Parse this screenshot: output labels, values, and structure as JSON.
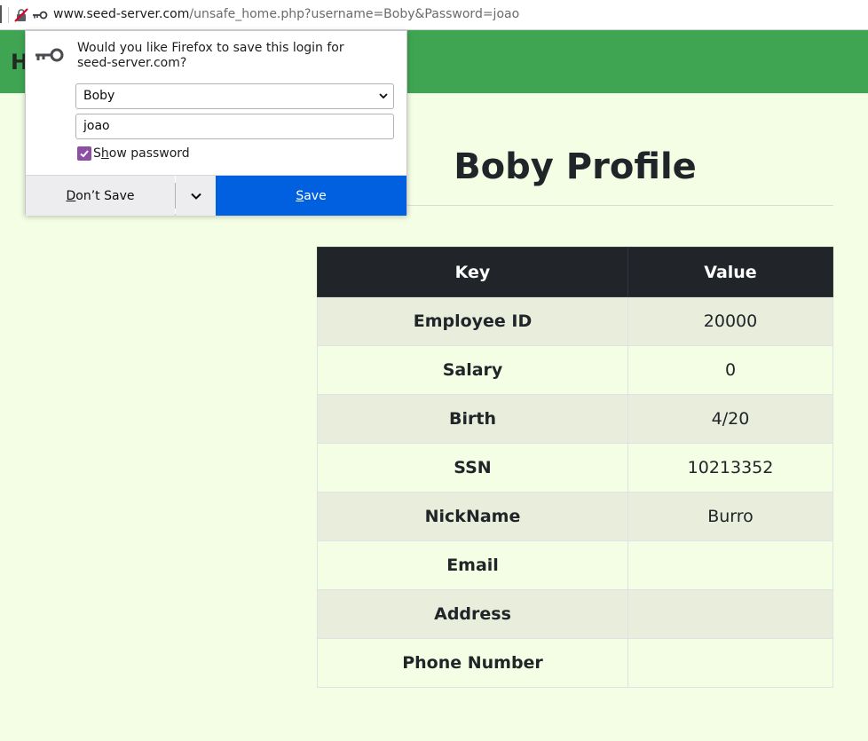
{
  "urlbar": {
    "url_host": "www.seed-server.com",
    "url_rest": "/unsafe_home.php?username=Boby&Password=joao",
    "icons": [
      "insecure-connection-icon",
      "key-icon"
    ]
  },
  "navbar": {
    "brand_partial": "H"
  },
  "page": {
    "title": "Boby Profile",
    "table": {
      "headers": [
        "Key",
        "Value"
      ],
      "rows": [
        {
          "key": "Employee ID",
          "value": "20000"
        },
        {
          "key": "Salary",
          "value": "0"
        },
        {
          "key": "Birth",
          "value": "4/20"
        },
        {
          "key": "SSN",
          "value": "10213352"
        },
        {
          "key": "NickName",
          "value": "Burro"
        },
        {
          "key": "Email",
          "value": ""
        },
        {
          "key": "Address",
          "value": ""
        },
        {
          "key": "Phone Number",
          "value": ""
        }
      ]
    }
  },
  "popup": {
    "question": "Would you like Firefox to save this login for seed-server.com?",
    "username_value": "Boby",
    "password_value": "joao",
    "show_password_label_prefix": "S",
    "show_password_label_hotkey": "h",
    "show_password_label_suffix": "ow password",
    "dont_save_hotkey": "D",
    "dont_save_rest": "on’t Save",
    "save_hotkey": "S",
    "save_rest": "ave",
    "colors": {
      "save_button": "#0060df",
      "checkbox": "#8c4fa5",
      "header": "#3fa552"
    }
  }
}
